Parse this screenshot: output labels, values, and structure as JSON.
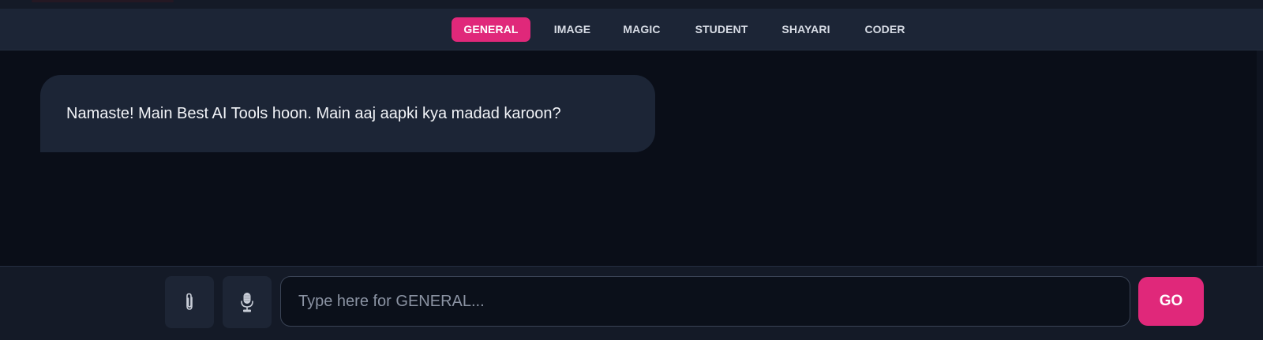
{
  "tabs": [
    {
      "label": "GENERAL",
      "active": true
    },
    {
      "label": "IMAGE",
      "active": false
    },
    {
      "label": "MAGIC",
      "active": false
    },
    {
      "label": "STUDENT",
      "active": false
    },
    {
      "label": "SHAYARI",
      "active": false
    },
    {
      "label": "CODER",
      "active": false
    }
  ],
  "chat": {
    "messages": [
      {
        "role": "assistant",
        "text": "Namaste! Main Best AI Tools hoon. Main aaj aapki kya madad karoon?"
      }
    ]
  },
  "composer": {
    "attach_icon": "paperclip-icon",
    "mic_icon": "microphone-icon",
    "value": "",
    "placeholder": "Type here for GENERAL...",
    "send_label": "GO"
  },
  "colors": {
    "accent": "#e0287a",
    "background": "#0a0e18",
    "panel": "#1c2536",
    "input_bar": "#141a27"
  }
}
